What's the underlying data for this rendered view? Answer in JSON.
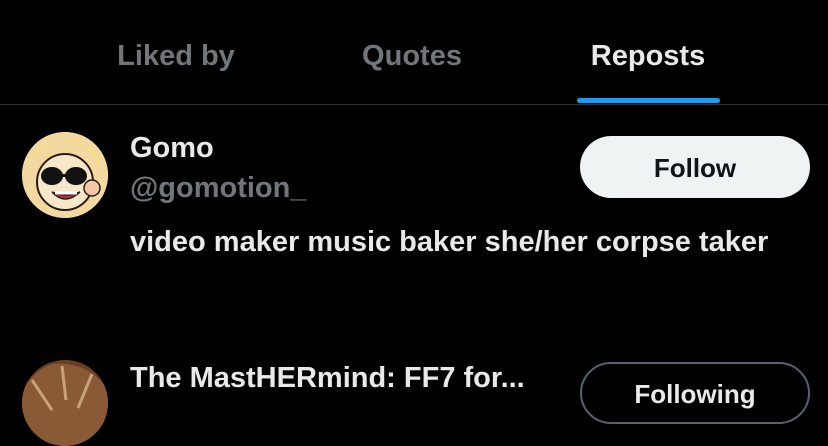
{
  "tabs": [
    {
      "label": "Liked by",
      "active": false
    },
    {
      "label": "Quotes",
      "active": false
    },
    {
      "label": "Reposts",
      "active": true
    }
  ],
  "users": [
    {
      "name": "Gomo",
      "handle": "@gomotion_",
      "bio": "video maker music baker she/her corpse taker",
      "button_label": "Follow",
      "avatar_icon": "cartoon-avatar-with-sunglasses"
    },
    {
      "name": "The MastHERmind: FF7 for...",
      "button_label": "Following",
      "avatar_icon": "illustrated-avatar"
    }
  ],
  "colors": {
    "background": "#000000",
    "primary_text": "#e7e9ea",
    "secondary_text": "#71767b",
    "accent": "#1d9bf0",
    "divider": "#2f3336"
  }
}
